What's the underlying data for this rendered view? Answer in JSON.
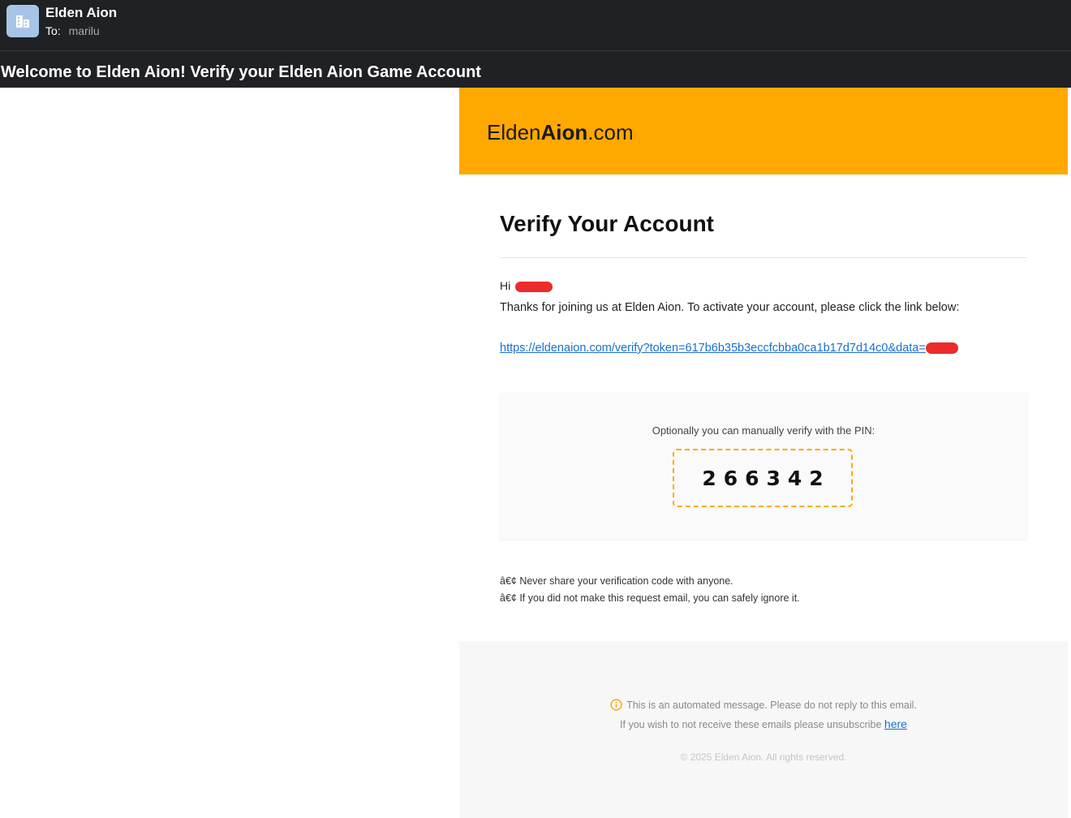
{
  "header": {
    "sender_name": "Elden Aion",
    "to_label": "To:",
    "to_name": "marilu",
    "subject": "Welcome to Elden Aion! Verify your Elden Aion Game Account"
  },
  "email": {
    "logo_prefix": "Elden",
    "logo_bold": "Aion",
    "logo_suffix": ".com",
    "heading": "Verify Your Account",
    "greeting": "Hi",
    "intro": "Thanks for joining us at Elden Aion. To activate your account, please click the link below:",
    "verify_link": "https://eldenaion.com/verify?token=617b6b35b3eccfcbba0ca1b17d7d14c0&data=",
    "pin_caption": "Optionally you can manually verify with the PIN:",
    "pin": "266342",
    "note_1": "â€¢ Never share your verification code with anyone.",
    "note_2": "â€¢ If you did not make this request email, you can safely ignore it."
  },
  "footer": {
    "automated": "This is an automated message. Please do not reply to this email.",
    "unsubscribe_text": "If you wish to not receive these emails please unsubscribe",
    "unsubscribe_link": "here",
    "copyright": "© 2025 Elden Aion. All rights reserved."
  },
  "colors": {
    "accent": "#ffa800",
    "header_bg": "#202124",
    "link": "#1a6fd1"
  },
  "icons": {
    "avatar": "building-icon",
    "info": "info-icon"
  }
}
